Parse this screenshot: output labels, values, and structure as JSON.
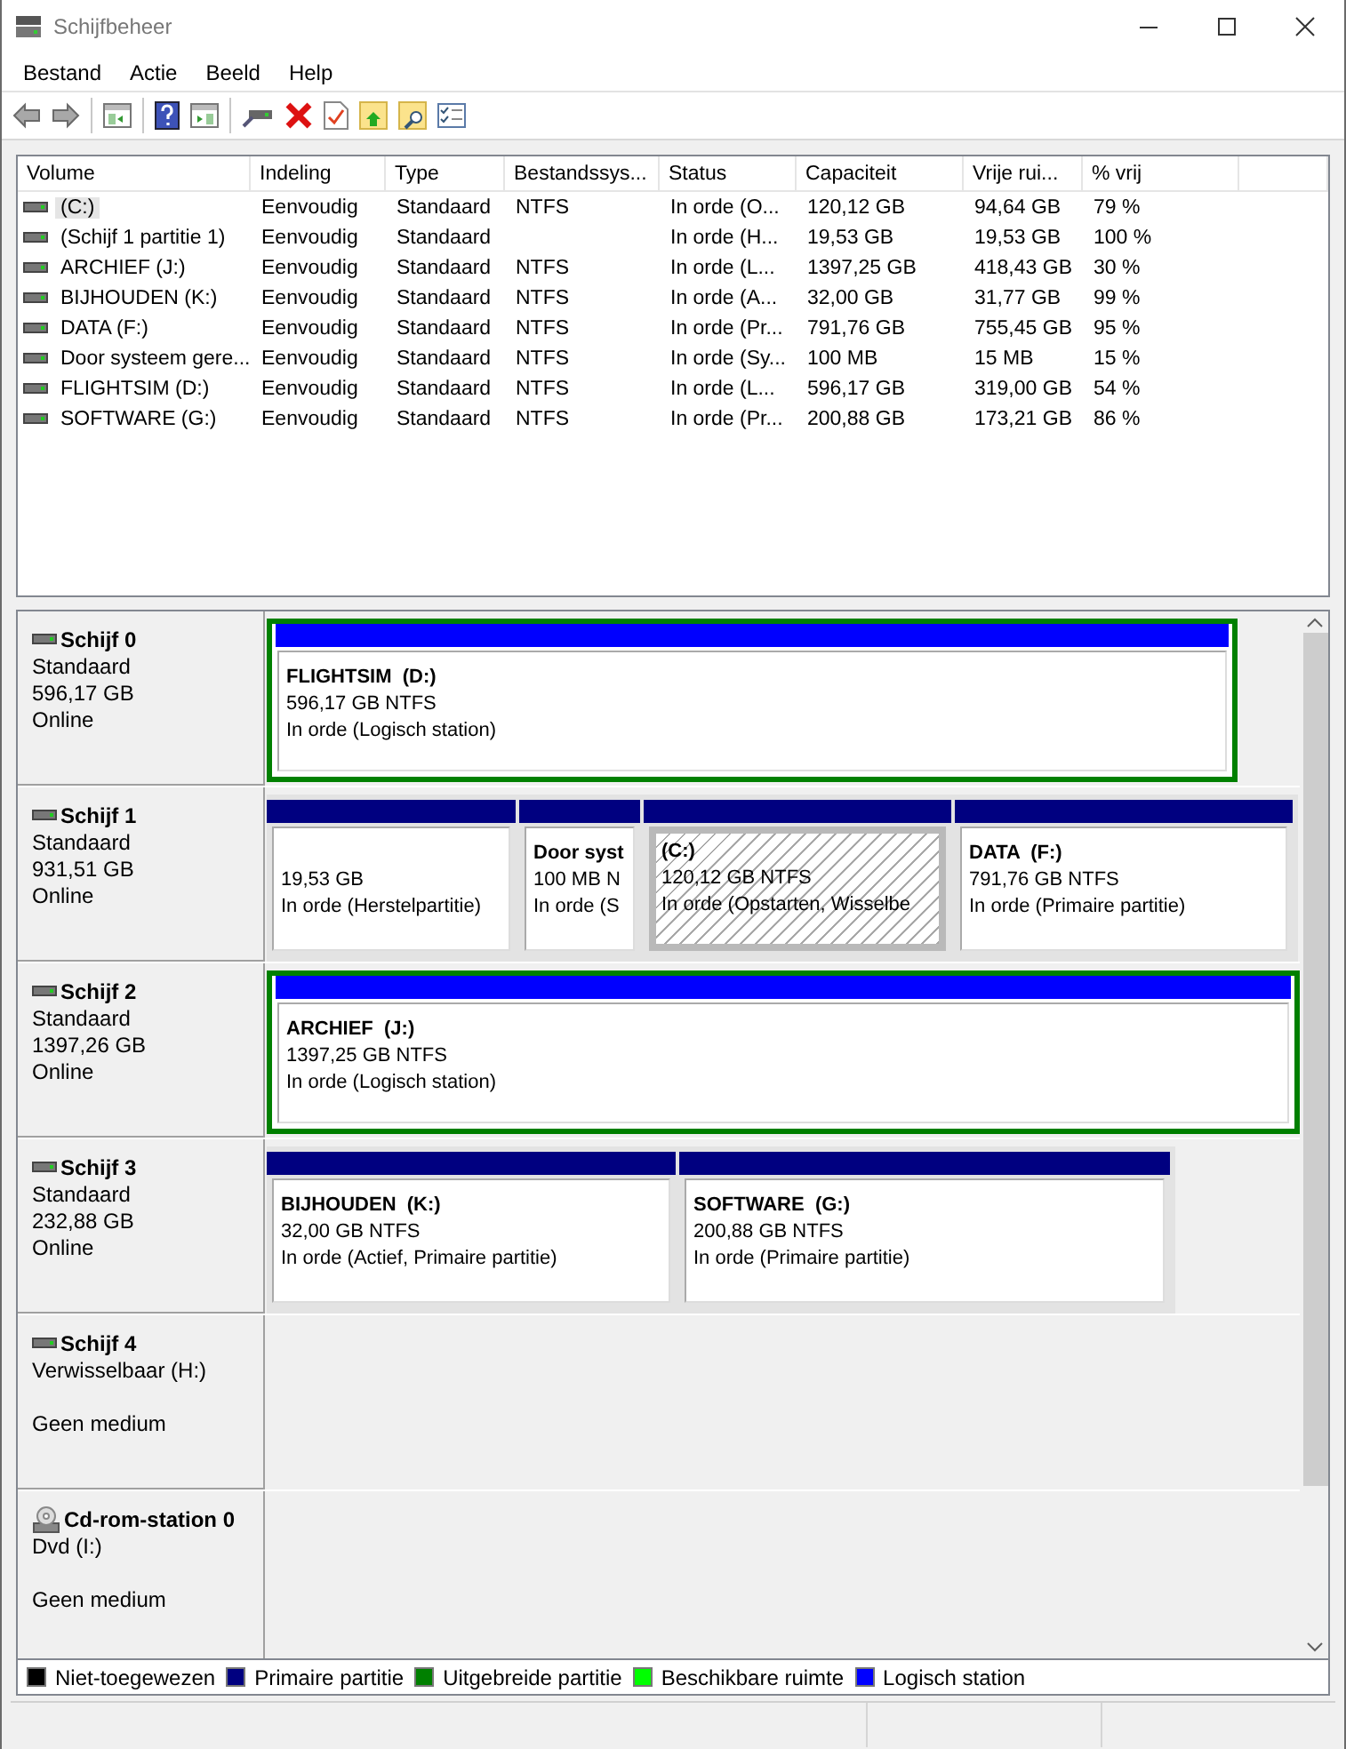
{
  "window": {
    "title": "Schijfbeheer"
  },
  "menu": [
    "Bestand",
    "Actie",
    "Beeld",
    "Help"
  ],
  "volumes": {
    "columns": [
      "Volume",
      "Indeling",
      "Type",
      "Bestandssys...",
      "Status",
      "Capaciteit",
      "Vrije rui...",
      "% vrij"
    ],
    "rows": [
      {
        "selected": true,
        "cells": [
          "(C:)",
          "Eenvoudig",
          "Standaard",
          "NTFS",
          "In orde (O...",
          "120,12 GB",
          "94,64 GB",
          "79 %"
        ]
      },
      {
        "selected": false,
        "cells": [
          "(Schijf 1 partitie 1)",
          "Eenvoudig",
          "Standaard",
          "",
          "In orde (H...",
          "19,53 GB",
          "19,53 GB",
          "100 %"
        ]
      },
      {
        "selected": false,
        "cells": [
          "ARCHIEF (J:)",
          "Eenvoudig",
          "Standaard",
          "NTFS",
          "In orde (L...",
          "1397,25 GB",
          "418,43 GB",
          "30 %"
        ]
      },
      {
        "selected": false,
        "cells": [
          "BIJHOUDEN (K:)",
          "Eenvoudig",
          "Standaard",
          "NTFS",
          "In orde (A...",
          "32,00 GB",
          "31,77 GB",
          "99 %"
        ]
      },
      {
        "selected": false,
        "cells": [
          "DATA (F:)",
          "Eenvoudig",
          "Standaard",
          "NTFS",
          "In orde (Pr...",
          "791,76 GB",
          "755,45 GB",
          "95 %"
        ]
      },
      {
        "selected": false,
        "cells": [
          "Door systeem gere...",
          "Eenvoudig",
          "Standaard",
          "NTFS",
          "In orde (Sy...",
          "100 MB",
          "15 MB",
          "15 %"
        ]
      },
      {
        "selected": false,
        "cells": [
          "FLIGHTSIM (D:)",
          "Eenvoudig",
          "Standaard",
          "NTFS",
          "In orde (L...",
          "596,17 GB",
          "319,00 GB",
          "54 %"
        ]
      },
      {
        "selected": false,
        "cells": [
          "SOFTWARE (G:)",
          "Eenvoudig",
          "Standaard",
          "NTFS",
          "In orde (Pr...",
          "200,88 GB",
          "173,21 GB",
          "86 %"
        ]
      }
    ]
  },
  "disks": [
    {
      "kind": "disk",
      "name": "Schijf 0",
      "type": "Standaard",
      "size": "596,17 GB",
      "status": "Online",
      "partitions": [
        {
          "kind": "logical",
          "selected": false,
          "name": "FLIGHTSIM  (D:)",
          "size": "596,17 GB NTFS",
          "status": "In orde (Logisch station)"
        }
      ]
    },
    {
      "kind": "disk",
      "name": "Schijf 1",
      "type": "Standaard",
      "size": "931,51 GB",
      "status": "Online",
      "partitions": [
        {
          "kind": "primary",
          "selected": false,
          "size": "19,53 GB",
          "status": "In orde (Herstelpartitie)"
        },
        {
          "kind": "primary",
          "selected": false,
          "name": "Door syst",
          "size": "100 MB N",
          "status": "In orde (S"
        },
        {
          "kind": "primary",
          "selected": true,
          "name": "(C:)",
          "size": "120,12 GB NTFS",
          "status": "In orde (Opstarten, Wisselbe"
        },
        {
          "kind": "primary",
          "selected": false,
          "name": "DATA  (F:)",
          "size": "791,76 GB NTFS",
          "status": "In orde (Primaire partitie)"
        }
      ]
    },
    {
      "kind": "disk",
      "name": "Schijf 2",
      "type": "Standaard",
      "size": "1397,26 GB",
      "status": "Online",
      "partitions": [
        {
          "kind": "logical",
          "selected": false,
          "name": "ARCHIEF  (J:)",
          "size": "1397,25 GB NTFS",
          "status": "In orde (Logisch station)"
        }
      ]
    },
    {
      "kind": "disk",
      "name": "Schijf 3",
      "type": "Standaard",
      "size": "232,88 GB",
      "status": "Online",
      "partitions": [
        {
          "kind": "primary",
          "selected": false,
          "name": "BIJHOUDEN  (K:)",
          "size": "32,00 GB NTFS",
          "status": "In orde (Actief, Primaire partitie)"
        },
        {
          "kind": "primary",
          "selected": false,
          "name": "SOFTWARE  (G:)",
          "size": "200,88 GB NTFS",
          "status": "In orde (Primaire partitie)"
        }
      ]
    },
    {
      "kind": "disk",
      "name": "Schijf 4",
      "type": "Verwisselbaar (H:)",
      "status": "Geen medium"
    },
    {
      "kind": "cdrom",
      "name": "Cd-rom-station 0",
      "type": "Dvd (I:)",
      "status": "Geen medium"
    }
  ],
  "legend": [
    {
      "label": "Niet-toegewezen",
      "color": "#000000"
    },
    {
      "label": "Primaire partitie",
      "color": "#000080"
    },
    {
      "label": "Uitgebreide partitie",
      "color": "#008000"
    },
    {
      "label": "Beschikbare ruimte",
      "color": "#00ff00"
    },
    {
      "label": "Logisch station",
      "color": "#0000ff"
    }
  ]
}
